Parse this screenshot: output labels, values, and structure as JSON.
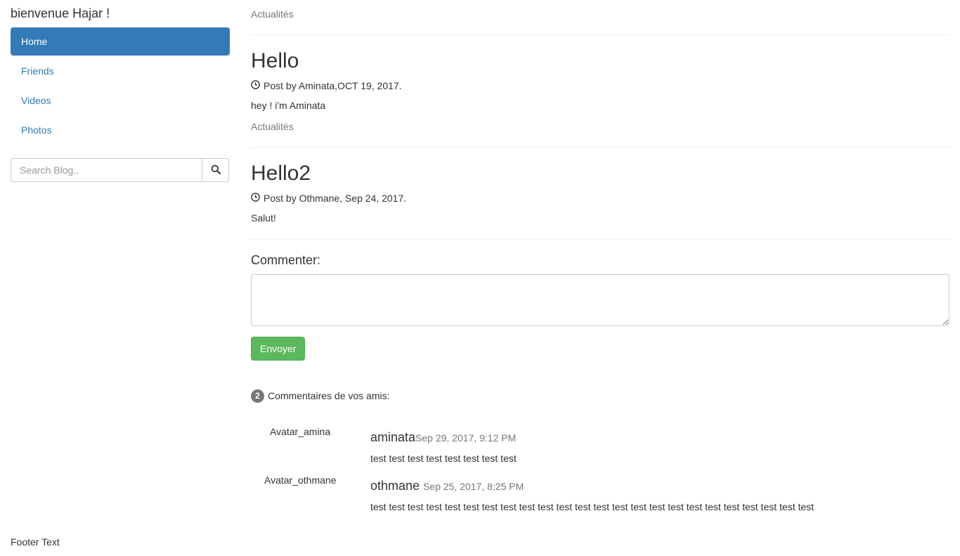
{
  "sidebar": {
    "welcome": "bienvenue Hajar !",
    "items": [
      {
        "label": "Home",
        "active": true
      },
      {
        "label": "Friends"
      },
      {
        "label": "Videos"
      },
      {
        "label": "Photos"
      }
    ],
    "search": {
      "placeholder": "Search Blog..",
      "value": "",
      "icon": "search-icon"
    }
  },
  "posts": [
    {
      "section": "Actualités",
      "title": "Hello",
      "meta": "Post by Aminata,OCT 19, 2017.",
      "meta_icon": "clock-icon",
      "body": "hey ! i'm Aminata"
    },
    {
      "section": "Actualités",
      "title": "Hello2",
      "meta": "Post by Othmane, Sep 24, 2017.",
      "meta_icon": "clock-icon",
      "body": "Salut!"
    }
  ],
  "comment_form": {
    "heading": "Commenter:",
    "value": "",
    "submit_label": "Envoyer"
  },
  "comments_section": {
    "count": "2",
    "label": "Commentaires de vos amis:",
    "items": [
      {
        "avatar": "Avatar_amina",
        "author": "aminata",
        "date": "Sep 29, 2017, 9:12 PM",
        "text": "test test test test test test test test"
      },
      {
        "avatar": "Avatar_othmane",
        "author": "othmane",
        "date": "Sep 25, 2017, 8:25 PM",
        "text": "test test test test test test test test test test test test test test test test test test test test test test test test"
      }
    ]
  },
  "footer": {
    "text": "Footer Text"
  },
  "colors": {
    "primary": "#337ab7",
    "success": "#5cb85c",
    "muted": "#777777",
    "text": "#333333"
  }
}
